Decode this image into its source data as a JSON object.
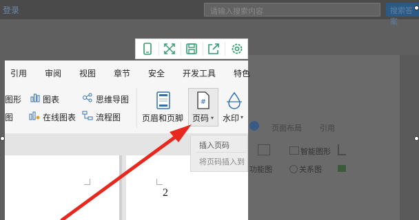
{
  "top_bar": {
    "brand": "登录",
    "search_placeholder": "请输入搜索内容",
    "search_button": "搜索答案"
  },
  "icon_toolbar": {
    "icons": [
      "phone-icon",
      "fullscreen-icon",
      "save-icon",
      "share-icon",
      "settings-icon"
    ],
    "accent": "#2e9b6e"
  },
  "menu_tabs": [
    "引用",
    "审阅",
    "视图",
    "章节",
    "安全",
    "开发工具",
    "特色"
  ],
  "ribbon": {
    "left_items": [
      "图形",
      "图表",
      "思维导图",
      "图",
      "在线图表",
      "流程图"
    ],
    "header_footer": "页眉和页脚",
    "page_number": "页码",
    "watermark": "水印"
  },
  "background_panel": {
    "tabs": [
      "页面布局",
      "引用"
    ],
    "items": [
      "智能图形",
      "功能图",
      "关系图"
    ]
  },
  "dropdown": {
    "title": "插入页码",
    "description": "将页码插入到"
  },
  "document": {
    "page_number_text": "2"
  },
  "colors": {
    "arrow": "#e8281e",
    "accent_green": "#2e9b6e",
    "ribbon_blue": "#2f6fb5"
  }
}
